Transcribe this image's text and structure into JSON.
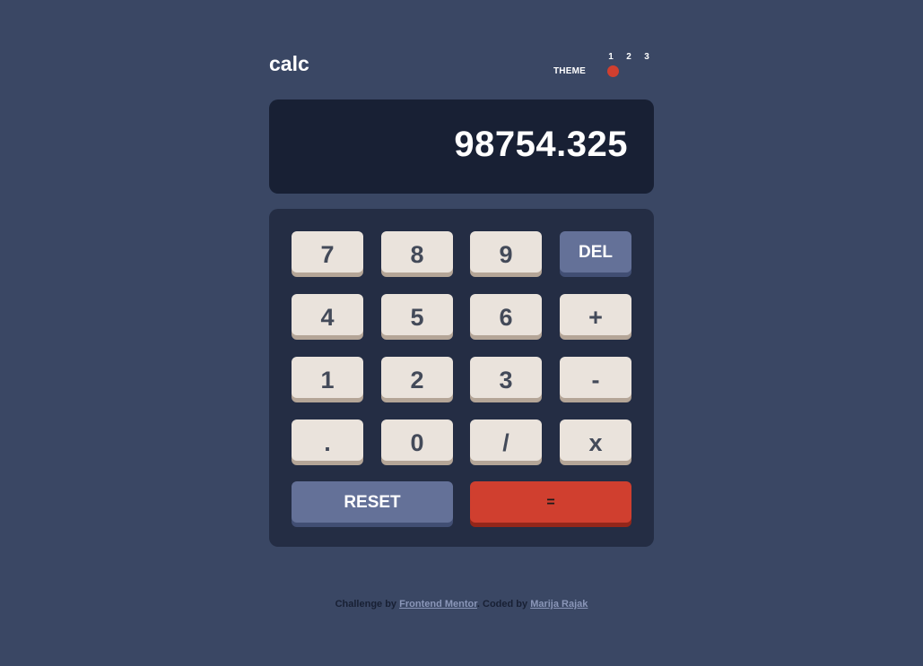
{
  "app": {
    "logo": "calc"
  },
  "theme": {
    "label": "THEME",
    "options": [
      "1",
      "2",
      "3"
    ],
    "selected": "1",
    "knob_color": "#d03f2f"
  },
  "display": {
    "value": "98754.325"
  },
  "keys": {
    "row1": [
      "7",
      "8",
      "9",
      "DEL"
    ],
    "row2": [
      "4",
      "5",
      "6",
      "+"
    ],
    "row3": [
      "1",
      "2",
      "3",
      "-"
    ],
    "row4": [
      ".",
      "0",
      "/",
      "x"
    ],
    "reset": "RESET",
    "equals": "="
  },
  "footer": {
    "challenge_prefix": "Challenge by ",
    "challenge_link": "Frontend Mentor",
    "coded_prefix": ". Coded by ",
    "coded_link": "Marija Rajak"
  },
  "colors": {
    "background": "#3a4764",
    "display_bg": "#182034",
    "keypad_bg": "#242d44",
    "key_bg": "#eae3dc",
    "key_shadow": "#b4a597",
    "accent_blue": "#647198",
    "accent_red": "#d03f2f"
  }
}
